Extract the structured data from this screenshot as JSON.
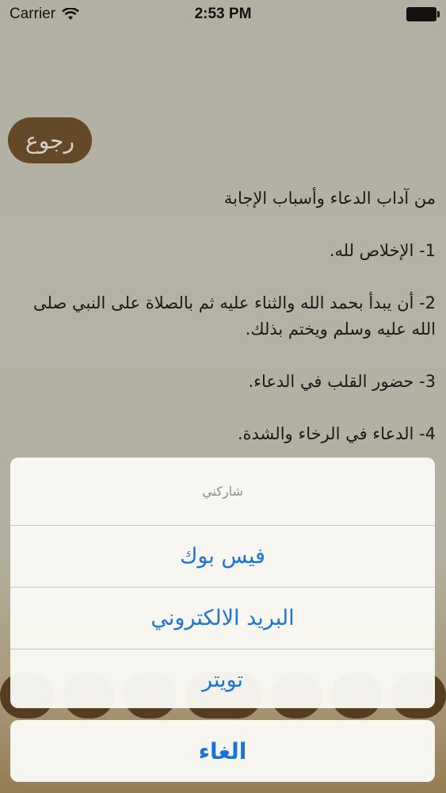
{
  "status_bar": {
    "carrier": "Carrier",
    "time": "2:53 PM"
  },
  "nav": {
    "back_label": "رجوع"
  },
  "content": {
    "heading": "من آداب الدعاء وأسباب الإجابة",
    "items": [
      "1- الإخلاص لله.",
      "2- أن يبدأ بحمد الله والثناء عليه ثم بالصلاة على النبي صلى الله عليه وسلم ويختم بذلك.",
      "3- حضور القلب في الدعاء.",
      "4- الدعاء في الرخاء والشدة."
    ]
  },
  "action_sheet": {
    "title": "شاركني",
    "options": [
      "فيس بوك",
      "البريد الالكتروني",
      "تويتر"
    ],
    "cancel_label": "الغاء"
  },
  "colors": {
    "accent": "#1a74d6",
    "button_brown": "#6e4f2c"
  }
}
